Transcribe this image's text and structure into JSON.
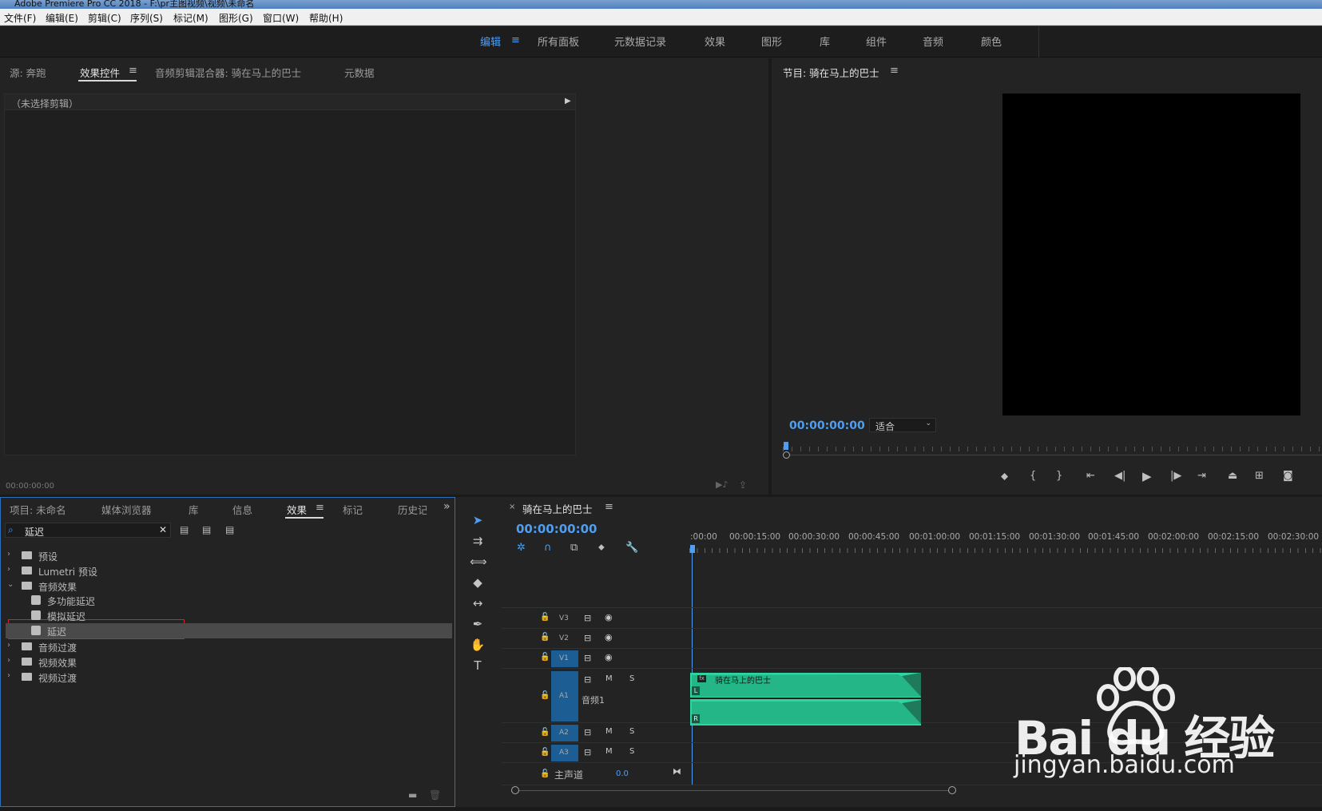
{
  "window": {
    "title": "Adobe Premiere Pro CC 2018 - F:\\pr主图视频\\视频\\未命名"
  },
  "menu": [
    "文件(F)",
    "编辑(E)",
    "剪辑(C)",
    "序列(S)",
    "标记(M)",
    "图形(G)",
    "窗口(W)",
    "帮助(H)"
  ],
  "workspaces": {
    "items": [
      "编辑",
      "所有面板",
      "元数据记录",
      "效果",
      "图形",
      "库",
      "组件",
      "音频",
      "颜色"
    ],
    "active": "编辑"
  },
  "source_panel": {
    "tabs": [
      "源: 奔跑",
      "效果控件",
      "音频剪辑混合器: 骑在马上的巴士",
      "元数据"
    ],
    "active_tab": "效果控件",
    "no_clip_label": "（未选择剪辑）",
    "timecode": "00:00:00:00"
  },
  "program_monitor": {
    "title": "节目: 骑在马上的巴士",
    "timecode": "00:00:00:00",
    "zoom": "适合"
  },
  "project_panel": {
    "tabs": [
      "项目: 未命名",
      "媒体浏览器",
      "库",
      "信息",
      "效果",
      "标记",
      "历史记"
    ],
    "active_tab": "效果",
    "search_value": "延迟",
    "tree": [
      {
        "label": "预设",
        "type": "folder",
        "expanded": false,
        "level": 0
      },
      {
        "label": "Lumetri 预设",
        "type": "folder",
        "expanded": false,
        "level": 0
      },
      {
        "label": "音频效果",
        "type": "folder",
        "expanded": true,
        "level": 0
      },
      {
        "label": "多功能延迟",
        "type": "effect",
        "level": 1
      },
      {
        "label": "模拟延迟",
        "type": "effect",
        "level": 1
      },
      {
        "label": "延迟",
        "type": "effect",
        "level": 1,
        "selected": true
      },
      {
        "label": "音频过渡",
        "type": "folder",
        "expanded": false,
        "level": 0
      },
      {
        "label": "视频效果",
        "type": "folder",
        "expanded": false,
        "level": 0
      },
      {
        "label": "视频过渡",
        "type": "folder",
        "expanded": false,
        "level": 0
      }
    ]
  },
  "timeline": {
    "sequence_name": "骑在马上的巴士",
    "timecode": "00:00:00:00",
    "ruler": [
      ":00:00",
      "00:00:15:00",
      "00:00:30:00",
      "00:00:45:00",
      "00:01:00:00",
      "00:01:15:00",
      "00:01:30:00",
      "00:01:45:00",
      "00:02:00:00",
      "00:02:15:00",
      "00:02:30:00"
    ],
    "video_tracks": [
      "V3",
      "V2",
      "V1"
    ],
    "audio_tracks": [
      "A1",
      "A2",
      "A3"
    ],
    "a1_name": "音频1",
    "mute_label": "M",
    "solo_label": "S",
    "master_label": "主声道",
    "master_value": "0.0",
    "clip_name": "骑在马上的巴士",
    "clip_channels": [
      "L",
      "R"
    ]
  },
  "watermark": {
    "brand": "Bai du 经验",
    "url": "jingyan.baidu.com"
  },
  "colors": {
    "accent": "#4e9ef2",
    "audio_clip": "#2dd6a0",
    "track_target": "#1c5d94",
    "highlight_box": "#e02020"
  }
}
